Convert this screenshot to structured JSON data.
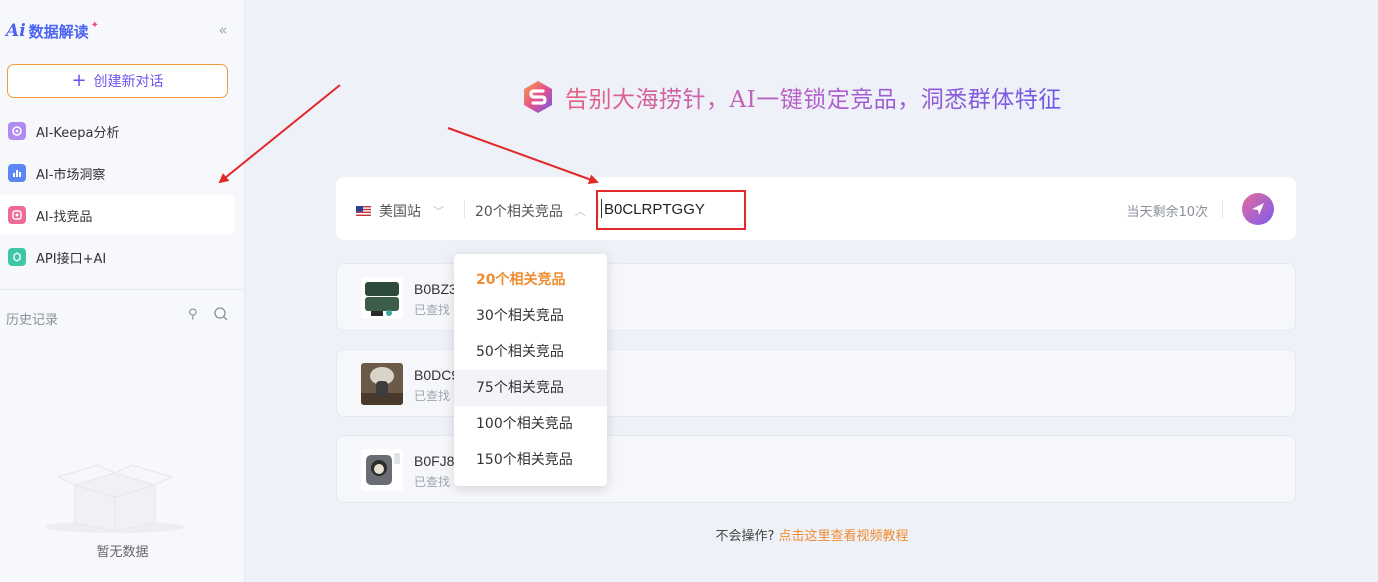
{
  "brand": {
    "ai": "Ai",
    "name": "数据解读"
  },
  "sidebar": {
    "new_chat": "创建新对话",
    "items": [
      {
        "label": "AI-Keepa分析",
        "icon": "keepa-icon",
        "color": "#b08cf0"
      },
      {
        "label": "AI-市场洞察",
        "icon": "bar-chart-icon",
        "color": "#5b86f3"
      },
      {
        "label": "AI-找竞品",
        "icon": "competitor-icon",
        "color": "#ee6a9a"
      },
      {
        "label": "API接口+AI",
        "icon": "api-icon",
        "color": "#3ec6a6"
      }
    ],
    "history_title": "历史记录",
    "empty_text": "暂无数据"
  },
  "hero": {
    "title": "告别大海捞针，AI一键锁定竞品，洞悉群体特征"
  },
  "search": {
    "site": "美国站",
    "count": "20个相关竞品",
    "asin": "B0CLRPTGGY",
    "remaining": "当天剩余10次"
  },
  "dropdown": {
    "options": [
      "20个相关竞品",
      "30个相关竞品",
      "50个相关竞品",
      "75个相关竞品",
      "100个相关竞品",
      "150个相关竞品"
    ],
    "selected": 0,
    "hovered": 3
  },
  "cards": [
    {
      "asin": "B0BZ3",
      "sub": "已查找"
    },
    {
      "asin": "B0DC9",
      "sub": "已查找"
    },
    {
      "asin": "B0FJ8",
      "sub": "已查找"
    }
  ],
  "help": {
    "text": "不会操作?",
    "link": "点击这里查看视频教程"
  },
  "colors": {
    "accent": "#f08c2e",
    "brand": "#4b63f2",
    "annotation": "#e3282a"
  }
}
